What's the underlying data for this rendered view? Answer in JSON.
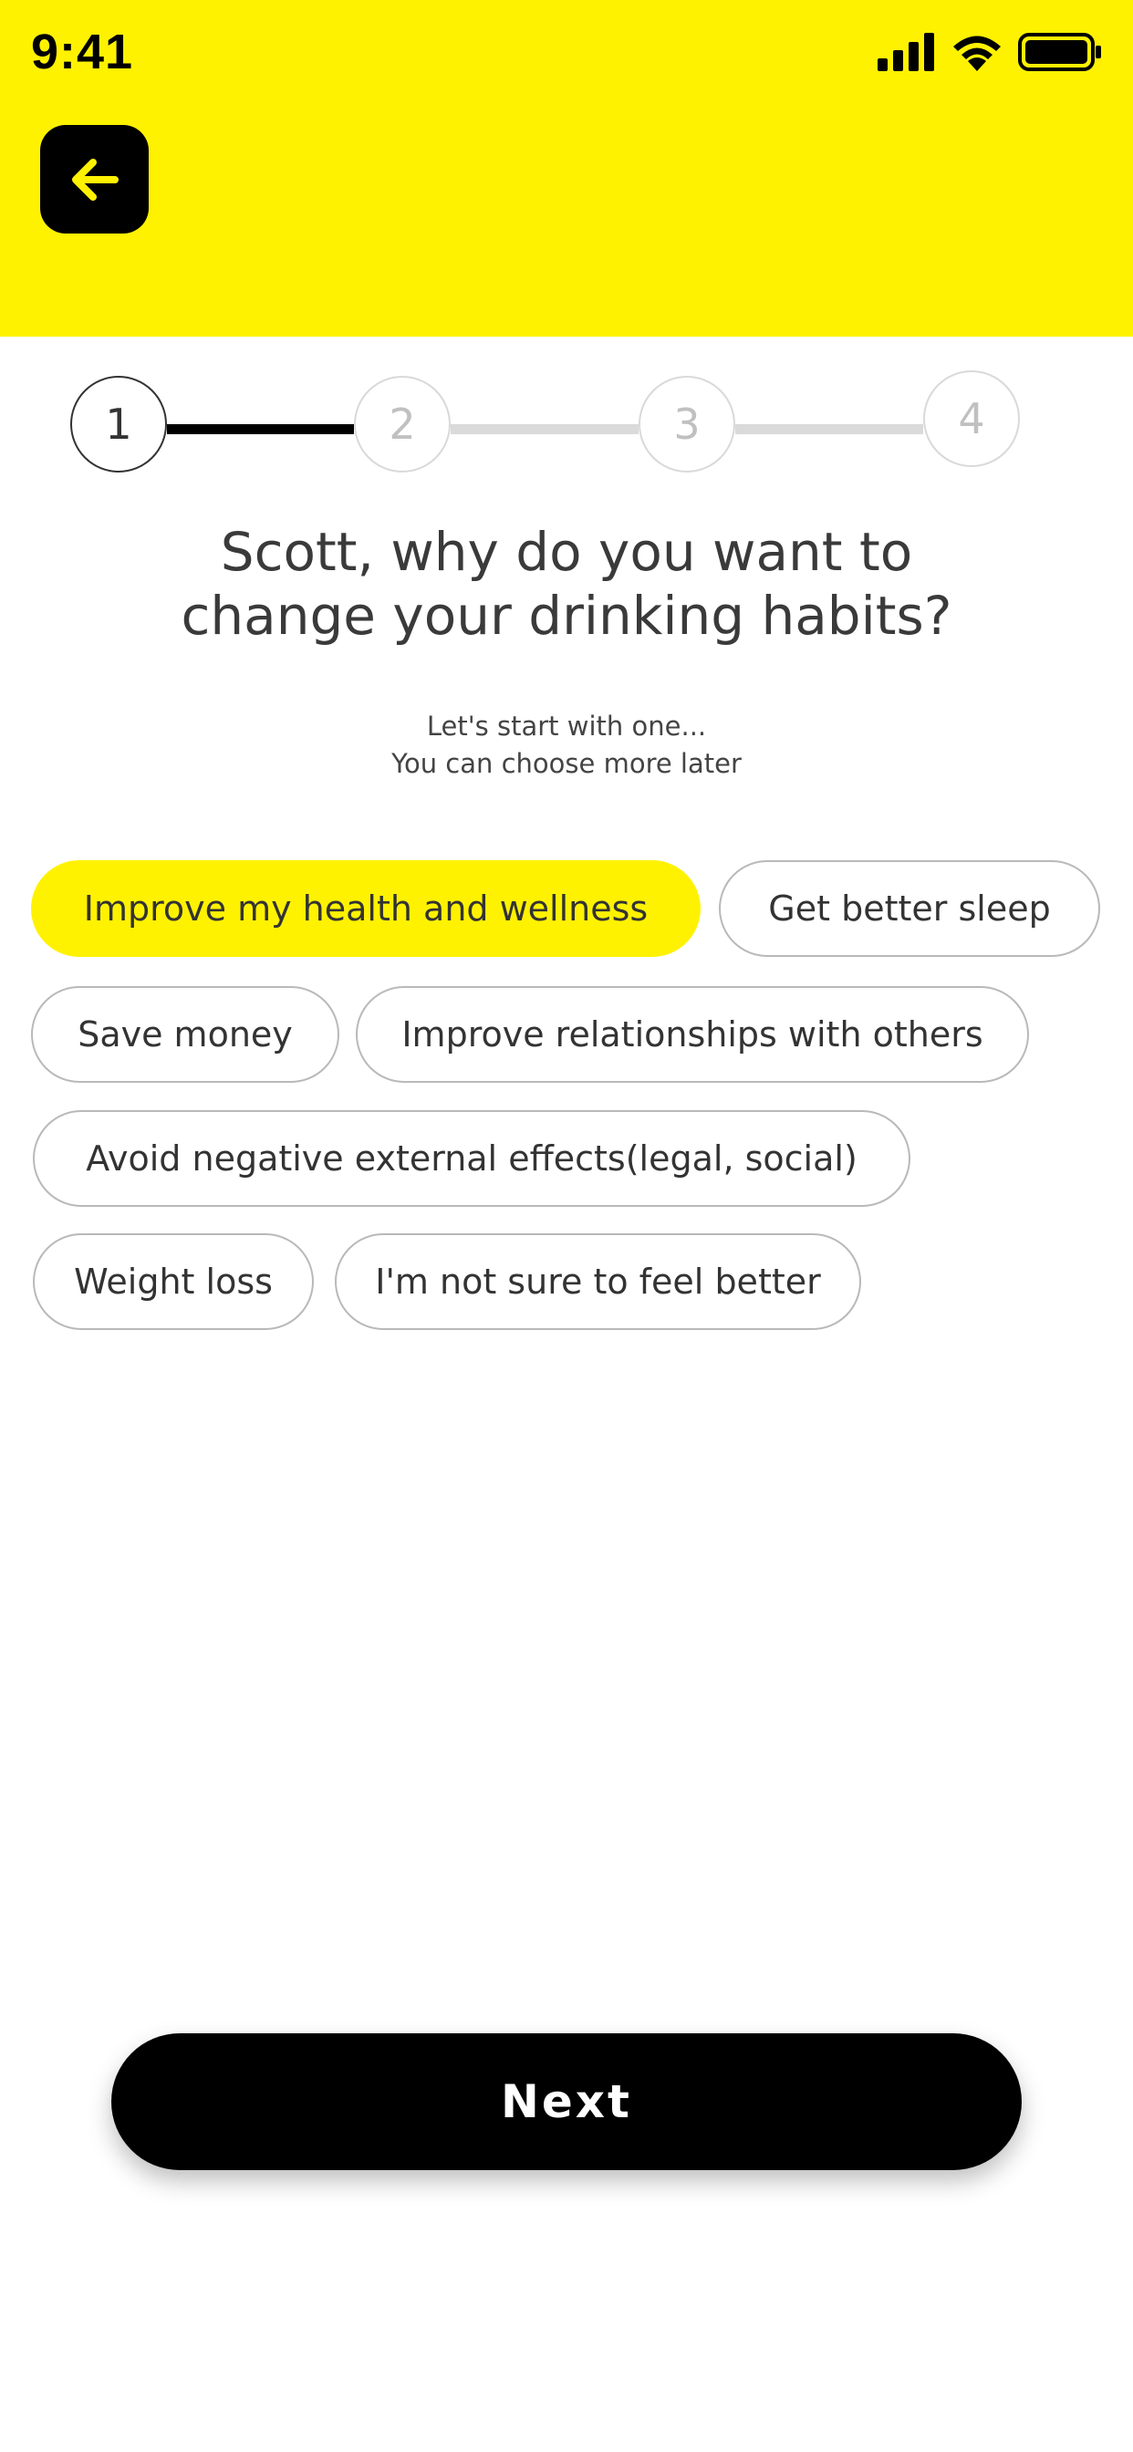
{
  "status_bar": {
    "time": "9:41",
    "icons": [
      "signal-icon",
      "wifi-icon",
      "battery-icon"
    ]
  },
  "header": {
    "background_color": "#FFF200",
    "back_icon": "arrow-left-icon"
  },
  "stepper": {
    "steps": [
      "1",
      "2",
      "3",
      "4"
    ],
    "current_step": 1
  },
  "question": {
    "line1": "Scott, why do you want to",
    "line2": "change your drinking habits?"
  },
  "subtext": {
    "line1": "Let's start with one...",
    "line2": "You can choose more later"
  },
  "options": [
    {
      "label": "Improve my health and wellness",
      "selected": true
    },
    {
      "label": "Get better sleep",
      "selected": false
    },
    {
      "label": "Save money",
      "selected": false
    },
    {
      "label": "Improve relationships with others",
      "selected": false
    },
    {
      "label": "Avoid negative external effects(legal, social)",
      "selected": false
    },
    {
      "label": "Weight loss",
      "selected": false
    },
    {
      "label": "I'm not sure to feel better",
      "selected": false
    }
  ],
  "next_button": {
    "label": "Next"
  },
  "colors": {
    "accent": "#FFF200",
    "button": "#000000"
  }
}
